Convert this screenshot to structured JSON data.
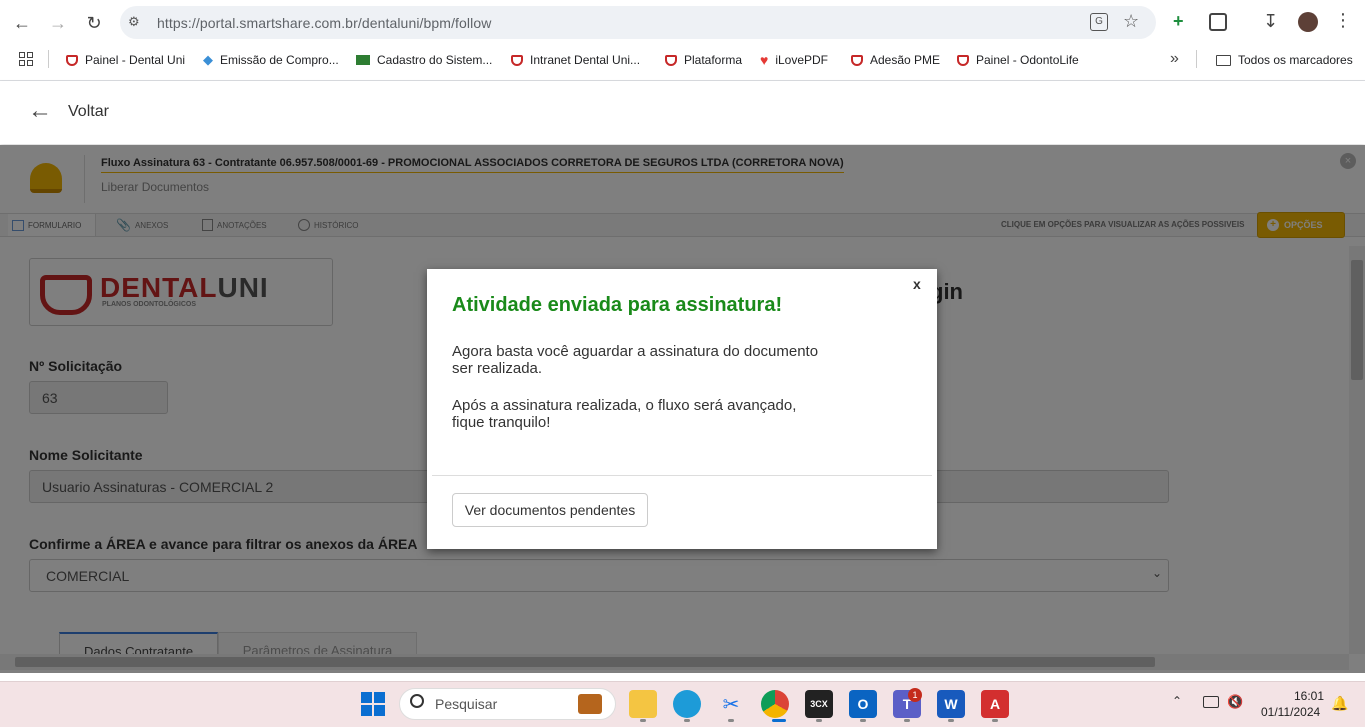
{
  "browser": {
    "url": "https://portal.smartshare.com.br/dentaluni/bpm/follow",
    "bookmarks": [
      "Painel - Dental Uni",
      "Emissão de Compro...",
      "Cadastro do Sistem...",
      "Intranet Dental Uni...",
      "Plataforma",
      "iLovePDF",
      "Adesão PME",
      "Painel - OdontoLife"
    ],
    "all_bookmarks": "Todos os marcadores",
    "more": "»"
  },
  "header": {
    "back_label": "Voltar"
  },
  "process": {
    "title": "Fluxo Assinatura 63 - Contratante 06.957.508/0001-69 - PROMOCIONAL ASSOCIADOS CORRETORA DE SEGUROS LTDA (CORRETORA NOVA)",
    "subtitle": "Liberar Documentos",
    "tabs": [
      "FORMULARIO",
      "ANEXOS",
      "ANOTAÇÕES",
      "HISTÓRICO"
    ],
    "hint": "CLIQUE EM OPÇÕES PARA VISUALIZAR AS AÇÕES POSSIVEIS",
    "options_label": "OPÇÕES"
  },
  "form": {
    "logo_main": "DENTAL",
    "logo_bold": "UNI",
    "logo_tag": "PLANOS ODONTOLÓGICOS",
    "partial_title": "gin",
    "request_label": "Nº Solicitação",
    "request_value": "63",
    "requester_label": "Nome Solicitante",
    "requester_value": "Usuario Assinaturas - COMERCIAL 2",
    "area_label": "Confirme a ÁREA e avance para filtrar os anexos da ÁREA",
    "area_value": "COMERCIAL",
    "subtabs": [
      "Dados Contratante",
      "Parâmetros de Assinatura"
    ]
  },
  "modal": {
    "close": "x",
    "title": "Atividade enviada para assinatura!",
    "line1": "Agora basta você aguardar a assinatura do documento",
    "line2": "ser realizada.",
    "line3": "Após a assinatura realizada, o fluxo será avançado,",
    "line4": "fique tranquilo!",
    "button": "Ver documentos pendentes"
  },
  "taskbar": {
    "search": "Pesquisar",
    "time": "16:01",
    "date": "01/11/2024",
    "teams_badge": "1",
    "threecx": "3CX"
  },
  "colors": {
    "modal_title": "#1a8a1a",
    "accent": "#c62828",
    "options": "#f2b705"
  }
}
